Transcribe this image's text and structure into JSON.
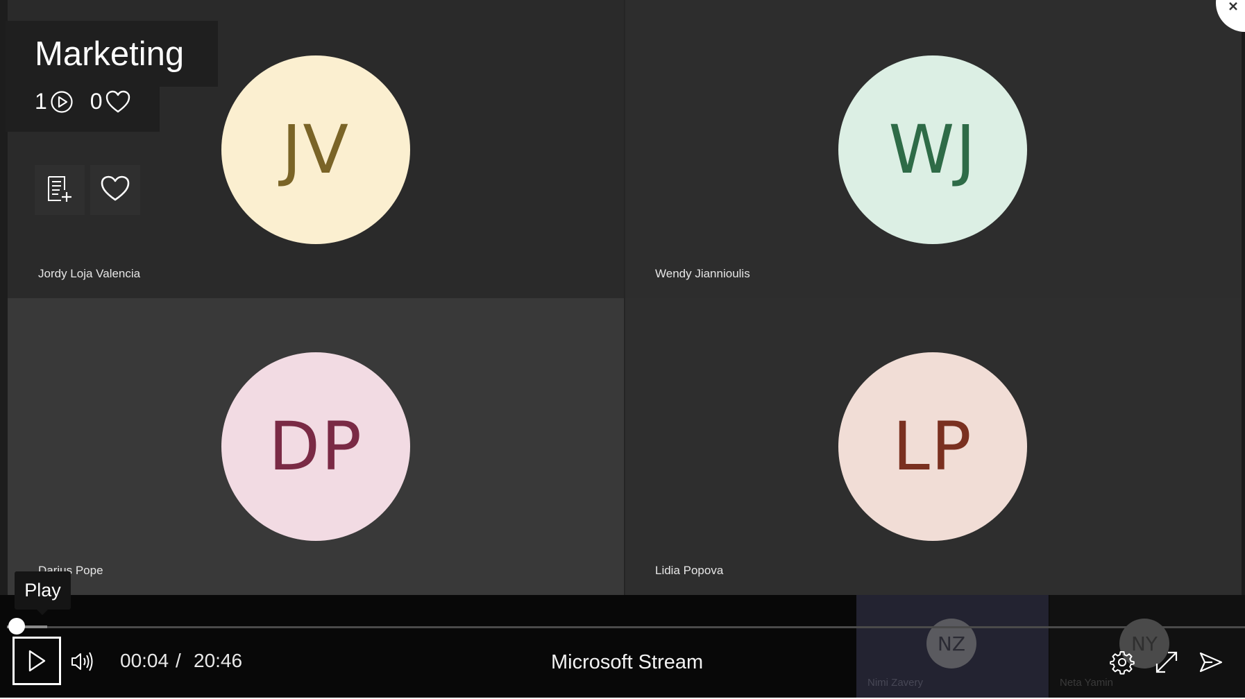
{
  "video": {
    "title": "Marketing",
    "views": "1",
    "likes": "0"
  },
  "participants": [
    {
      "initials": "JV",
      "name": "Jordy Loja Valencia",
      "bg": "#fbefd0",
      "fg": "#7a6427"
    },
    {
      "initials": "WJ",
      "name": "Wendy Jiannioulis",
      "bg": "#dcefe4",
      "fg": "#2e6b47"
    },
    {
      "initials": "DP",
      "name": "Darius Pope",
      "bg": "#f2dbe3",
      "fg": "#7a2a45"
    },
    {
      "initials": "LP",
      "name": "Lidia Popova",
      "bg": "#f1ddd6",
      "fg": "#7a3020"
    }
  ],
  "thumbnails": [
    {
      "initials": "NZ",
      "name": "Nimi Zavery"
    },
    {
      "initials": "NY",
      "name": "Neta Yamin"
    }
  ],
  "player": {
    "tooltip": "Play",
    "current_time": "00:04",
    "separator": "/",
    "duration": "20:46",
    "brand": "Microsoft Stream",
    "progress_fraction": 0.003
  },
  "icons": {
    "views": "play-circle-icon",
    "likes": "heart-icon",
    "add_to_playlist": "playlist-add-icon",
    "like": "heart-outline-icon",
    "play": "play-icon",
    "volume": "volume-icon",
    "settings": "gear-icon",
    "fullscreen": "expand-icon",
    "share": "share-icon",
    "close": "close-icon"
  }
}
